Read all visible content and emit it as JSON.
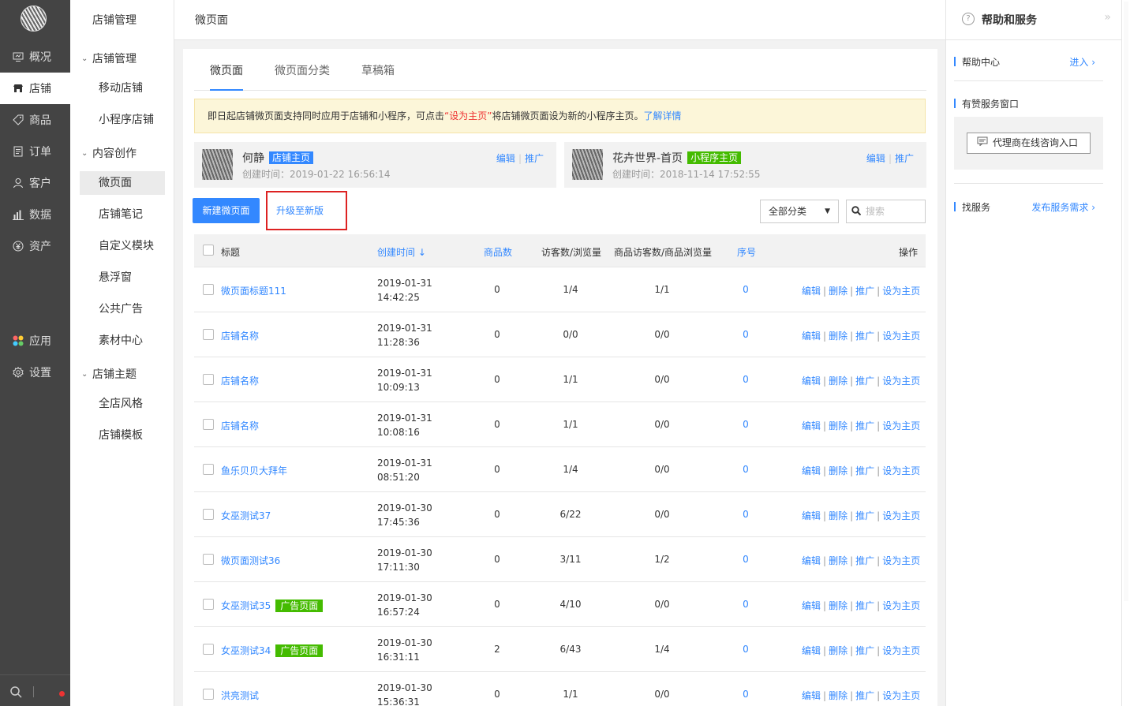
{
  "primary_nav": [
    {
      "label": "概况",
      "icon": "monitor-icon"
    },
    {
      "label": "店铺",
      "icon": "store-icon",
      "active": true
    },
    {
      "label": "商品",
      "icon": "tag-icon"
    },
    {
      "label": "订单",
      "icon": "list-icon"
    },
    {
      "label": "客户",
      "icon": "user-icon"
    },
    {
      "label": "数据",
      "icon": "bar-chart-icon"
    },
    {
      "label": "资产",
      "icon": "yen-icon"
    },
    {
      "label": "应用",
      "icon": "apps-icon"
    },
    {
      "label": "设置",
      "icon": "gear-icon"
    }
  ],
  "secondary_nav": {
    "title": "店铺管理",
    "groups": [
      {
        "label": "店铺管理",
        "items": [
          "移动店铺",
          "小程序店铺"
        ]
      },
      {
        "label": "内容创作",
        "items": [
          "微页面",
          "店铺笔记",
          "自定义模块",
          "悬浮窗",
          "公共广告",
          "素材中心"
        ]
      },
      {
        "label": "店铺主题",
        "items": [
          "全店风格",
          "店铺模板"
        ]
      }
    ],
    "active_item": "微页面"
  },
  "topbar": {
    "title": "微页面"
  },
  "tabs": [
    "微页面",
    "微页面分类",
    "草稿箱"
  ],
  "notice": {
    "pre": "即日起店铺微页面支持同时应用于店铺和小程序，可点击",
    "highlight": "“设为主页”",
    "post": "将店铺微页面设为新的小程序主页。",
    "link": "了解详情"
  },
  "homepage_cards": [
    {
      "name": "何静",
      "tag": "店铺主页",
      "tag_color": "#38f",
      "created": "创建时间：2019-01-22 16:56:14",
      "edit": "编辑",
      "promote": "推广"
    },
    {
      "name": "花卉世界-首页",
      "tag": "小程序主页",
      "tag_color": "#4b0",
      "created": "创建时间：2018-11-14 17:52:55",
      "edit": "编辑",
      "promote": "推广"
    }
  ],
  "actions": {
    "new_page": "新建微页面",
    "upgrade": "升级至新版",
    "category": "全部分类",
    "search_placeholder": "搜索"
  },
  "table": {
    "headers": {
      "title": "标题",
      "created": "创建时间",
      "goods": "商品数",
      "visits": "访客数/浏览量",
      "goods_visits": "商品访客数/商品浏览量",
      "seq": "序号",
      "ops": "操作"
    },
    "sort_indicator": "↓",
    "ops": [
      "编辑",
      "删除",
      "推广",
      "设为主页"
    ],
    "rows": [
      {
        "title": "微页面标题111",
        "date": "2019-01-31",
        "time": "14:42:25",
        "goods": "0",
        "visits": "1/4",
        "goods_visits": "1/1",
        "seq": "0",
        "tag": ""
      },
      {
        "title": "店铺名称",
        "date": "2019-01-31",
        "time": "11:28:36",
        "goods": "0",
        "visits": "0/0",
        "goods_visits": "0/0",
        "seq": "0",
        "tag": ""
      },
      {
        "title": "店铺名称",
        "date": "2019-01-31",
        "time": "10:09:13",
        "goods": "0",
        "visits": "1/1",
        "goods_visits": "0/0",
        "seq": "0",
        "tag": ""
      },
      {
        "title": "店铺名称",
        "date": "2019-01-31",
        "time": "10:08:16",
        "goods": "0",
        "visits": "1/1",
        "goods_visits": "0/0",
        "seq": "0",
        "tag": ""
      },
      {
        "title": "鱼乐贝贝大拜年",
        "date": "2019-01-31",
        "time": "08:51:20",
        "goods": "0",
        "visits": "1/4",
        "goods_visits": "0/0",
        "seq": "0",
        "tag": ""
      },
      {
        "title": "女巫测试37",
        "date": "2019-01-30",
        "time": "17:45:36",
        "goods": "0",
        "visits": "6/22",
        "goods_visits": "0/0",
        "seq": "0",
        "tag": ""
      },
      {
        "title": "微页面测试36",
        "date": "2019-01-30",
        "time": "17:11:30",
        "goods": "0",
        "visits": "3/11",
        "goods_visits": "1/2",
        "seq": "0",
        "tag": ""
      },
      {
        "title": "女巫测试35",
        "date": "2019-01-30",
        "time": "16:57:24",
        "goods": "0",
        "visits": "4/10",
        "goods_visits": "0/0",
        "seq": "0",
        "tag": "广告页面"
      },
      {
        "title": "女巫测试34",
        "date": "2019-01-30",
        "time": "16:31:11",
        "goods": "2",
        "visits": "6/43",
        "goods_visits": "1/4",
        "seq": "0",
        "tag": "广告页面"
      },
      {
        "title": "洪亮测试",
        "date": "2019-01-30",
        "time": "15:36:31",
        "goods": "0",
        "visits": "1/1",
        "goods_visits": "0/0",
        "seq": "0",
        "tag": ""
      }
    ]
  },
  "help_panel": {
    "title": "帮助和服务",
    "help_center": "帮助中心",
    "enter": "进入",
    "service_window": "有赞服务窗口",
    "consult": "代理商在线咨询入口",
    "find_service": "找服务",
    "publish": "发布服务需求"
  },
  "colors": {
    "accent": "#3388ff",
    "sidebar": "#444444",
    "notice_bg": "#fcf6d9",
    "highlight": "#ee3333",
    "tag_green": "#44bb00"
  }
}
